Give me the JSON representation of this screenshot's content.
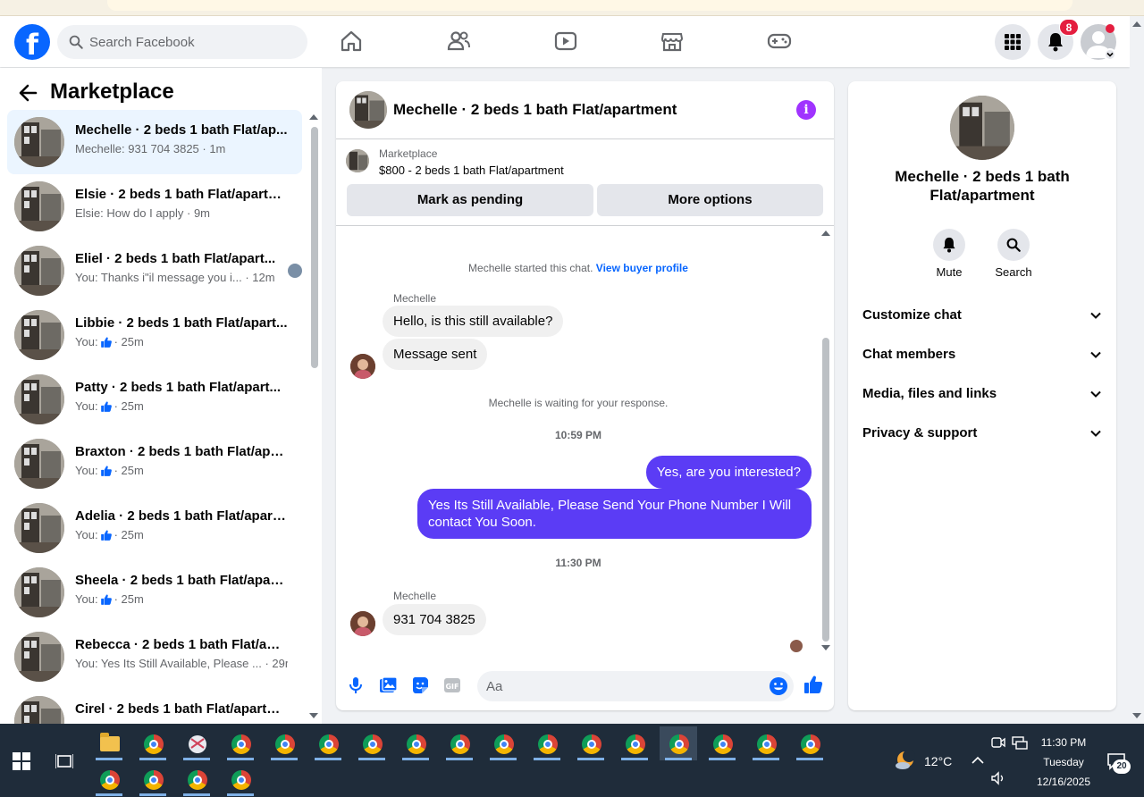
{
  "nav": {
    "logo": "f",
    "search_placeholder": "Search Facebook",
    "notifications_count": "8"
  },
  "left": {
    "title": "Marketplace",
    "conversations": [
      {
        "title": "Mechelle · 2 beds 1 bath Flat/ap...",
        "sub": "Mechelle: 931 704 3825 · 1m",
        "active": true
      },
      {
        "title": "Elsie · 2 beds 1 bath Flat/apartm...",
        "sub": "Elsie: How do I apply · 9m"
      },
      {
        "title": "Eliel · 2 beds 1 bath Flat/apart...",
        "sub": "You: Thanks i\"il message you i... · 12m",
        "seen": true
      },
      {
        "title": "Libbie · 2 beds 1 bath Flat/apart...",
        "sub_prefix": "You:",
        "sub_suffix": "· 25m",
        "like": true
      },
      {
        "title": "Patty · 2 beds 1 bath Flat/apart...",
        "sub_prefix": "You:",
        "sub_suffix": "· 25m",
        "like": true
      },
      {
        "title": "Braxton · 2 beds 1 bath Flat/apar...",
        "sub_prefix": "You:",
        "sub_suffix": "· 25m",
        "like": true
      },
      {
        "title": "Adelia · 2 beds 1 bath Flat/apart...",
        "sub_prefix": "You:",
        "sub_suffix": "· 25m",
        "like": true
      },
      {
        "title": "Sheela · 2 beds 1 bath Flat/apart...",
        "sub_prefix": "You:",
        "sub_suffix": "· 25m",
        "like": true
      },
      {
        "title": "Rebecca · 2 beds 1 bath Flat/apa...",
        "sub": "You: Yes Its Still Available, Please ... · 29m"
      },
      {
        "title": "Cirel · 2 beds 1 bath Flat/apartm...",
        "sub": ""
      }
    ]
  },
  "chat": {
    "title": "Mechelle · 2 beds 1 bath Flat/apartment",
    "listing_source": "Marketplace",
    "listing_price": "$800 - 2 beds 1 bath Flat/apartment",
    "mark_pending": "Mark as pending",
    "more_options": "More options",
    "started_text": "Mechelle started this chat.",
    "view_profile": "View buyer profile",
    "sender": "Mechelle",
    "msg1": "Hello, is this still available?",
    "msg2": "Message sent",
    "waiting": "Mechelle is waiting for your response.",
    "time1": "10:59 PM",
    "out1": "Yes, are you interested?",
    "out2": "Yes Its Still Available, Please Send Your Phone Number I Will contact You Soon.",
    "time2": "11:30 PM",
    "sender2": "Mechelle",
    "msg3": "931 704 3825",
    "composer_placeholder": "Aa"
  },
  "right": {
    "title": "Mechelle · 2 beds 1 bath Flat/apartment",
    "mute": "Mute",
    "search": "Search",
    "rows": [
      "Customize chat",
      "Chat members",
      "Media, files and links",
      "Privacy & support"
    ]
  },
  "taskbar": {
    "temperature": "12°C",
    "time": "11:30 PM",
    "day": "Tuesday",
    "date": "12/16/2025",
    "notif_count": "20"
  },
  "colors": {
    "accent": "#0866ff",
    "outgoing_bubble": "#5b3cf5",
    "info": "#a033ff"
  }
}
